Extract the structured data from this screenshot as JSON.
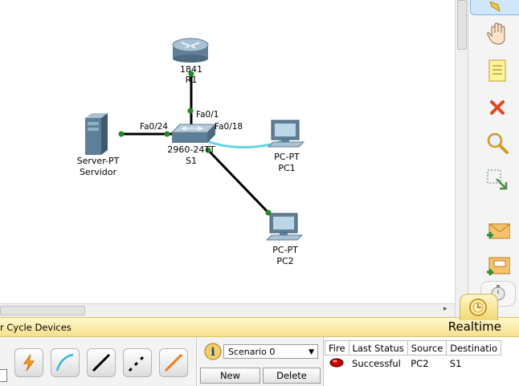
{
  "topology": {
    "devices": {
      "router": {
        "model": "1841",
        "name": "R1"
      },
      "switch": {
        "model": "2960-24TT",
        "name": "S1"
      },
      "server": {
        "model": "Server-PT",
        "name": "Servidor"
      },
      "pc1": {
        "model": "PC-PT",
        "name": "PC1"
      },
      "pc2": {
        "model": "PC-PT",
        "name": "PC2"
      }
    },
    "ports": {
      "switch_to_router": "Fa0/1",
      "switch_to_server": "Fa0/24",
      "switch_to_pc1": "Fa0/18"
    },
    "colors": {
      "copper_link": "#000000",
      "console_link": "#5fd3e6",
      "link_up_dot": "#1f8a1f"
    }
  },
  "realtime_bar": {
    "cycle_devices": "r Cycle Devices",
    "mode": "Realtime"
  },
  "scenario": {
    "selected": "Scenario 0",
    "new_label": "New",
    "delete_label": "Delete"
  },
  "pdu_table": {
    "headers": [
      "Fire",
      "Last Status",
      "Source",
      "Destinatio"
    ],
    "rows": [
      {
        "last_status": "Successful",
        "source": "PC2",
        "destination": "S1"
      }
    ]
  }
}
